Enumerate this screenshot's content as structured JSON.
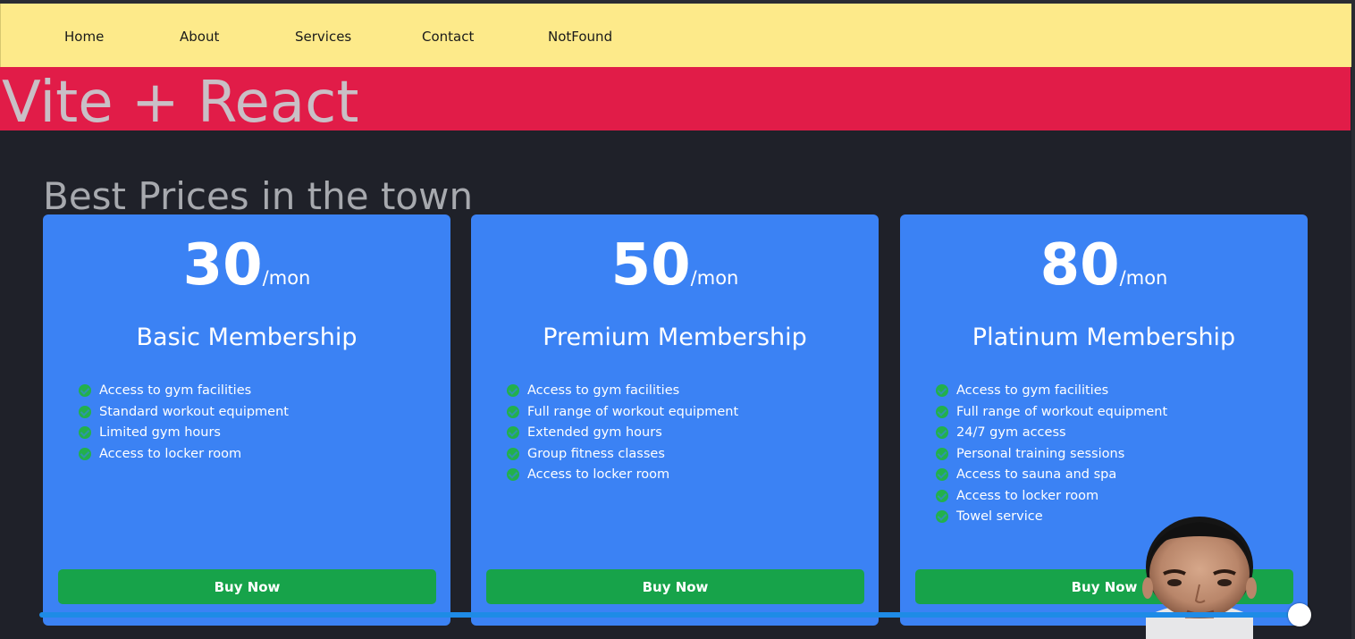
{
  "nav": {
    "items": [
      {
        "label": "Home"
      },
      {
        "label": "About"
      },
      {
        "label": "Services"
      },
      {
        "label": "Contact"
      },
      {
        "label": "NotFound"
      }
    ]
  },
  "banner": {
    "title": "Vite + React"
  },
  "pricing": {
    "heading": "Best Prices in the town",
    "plans": [
      {
        "price": "30",
        "unit": "/mon",
        "name": "Basic Membership",
        "features": [
          "Access to gym facilities",
          "Standard workout equipment",
          "Limited gym hours",
          "Access to locker room"
        ],
        "button": "Buy Now"
      },
      {
        "price": "50",
        "unit": "/mon",
        "name": "Premium Membership",
        "features": [
          "Access to gym facilities",
          "Full range of workout equipment",
          "Extended gym hours",
          "Group fitness classes",
          "Access to locker room"
        ],
        "button": "Buy Now"
      },
      {
        "price": "80",
        "unit": "/mon",
        "name": "Platinum Membership",
        "features": [
          "Access to gym facilities",
          "Full range of workout equipment",
          "24/7 gym access",
          "Personal training sessions",
          "Access to sauna and spa",
          "Access to locker room",
          "Towel service"
        ],
        "button": "Buy Now"
      }
    ]
  },
  "video": {
    "progress": 1.0
  },
  "colors": {
    "nav_bg": "#fdea8a",
    "banner_bg": "#e11c48",
    "page_bg": "#1f2129",
    "card_bg": "#3b82f4",
    "button_bg": "#17a34a",
    "check": "#22b04c",
    "seekbar": "#1e8be6"
  }
}
